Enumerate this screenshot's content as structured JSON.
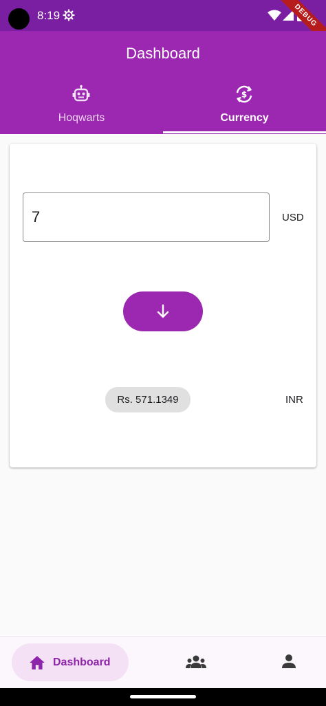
{
  "status_bar": {
    "time": "8:19",
    "debug_label": "DEBUG",
    "icons": [
      "gear-icon",
      "wifi-icon",
      "signal-icon",
      "battery-icon"
    ]
  },
  "app_bar": {
    "title": "Dashboard",
    "tabs": [
      {
        "label": "Hoqwarts",
        "icon": "robot-icon",
        "selected": false
      },
      {
        "label": "Currency",
        "icon": "currency-exchange-icon",
        "selected": true
      }
    ]
  },
  "converter": {
    "amount_value": "7",
    "from_currency": "USD",
    "convert_icon": "arrow-down-icon",
    "result": "Rs. 571.1349",
    "to_currency": "INR"
  },
  "bottom_nav": {
    "items": [
      {
        "label": "Dashboard",
        "icon": "home-icon",
        "selected": true
      },
      {
        "label": "",
        "icon": "group-icon",
        "selected": false
      },
      {
        "label": "",
        "icon": "person-icon",
        "selected": false
      }
    ]
  },
  "colors": {
    "primary": "#9c27b0",
    "status_bar": "#7b1fa2",
    "nav_highlight": "#f4e1f6",
    "chip": "#e0e0e0"
  }
}
